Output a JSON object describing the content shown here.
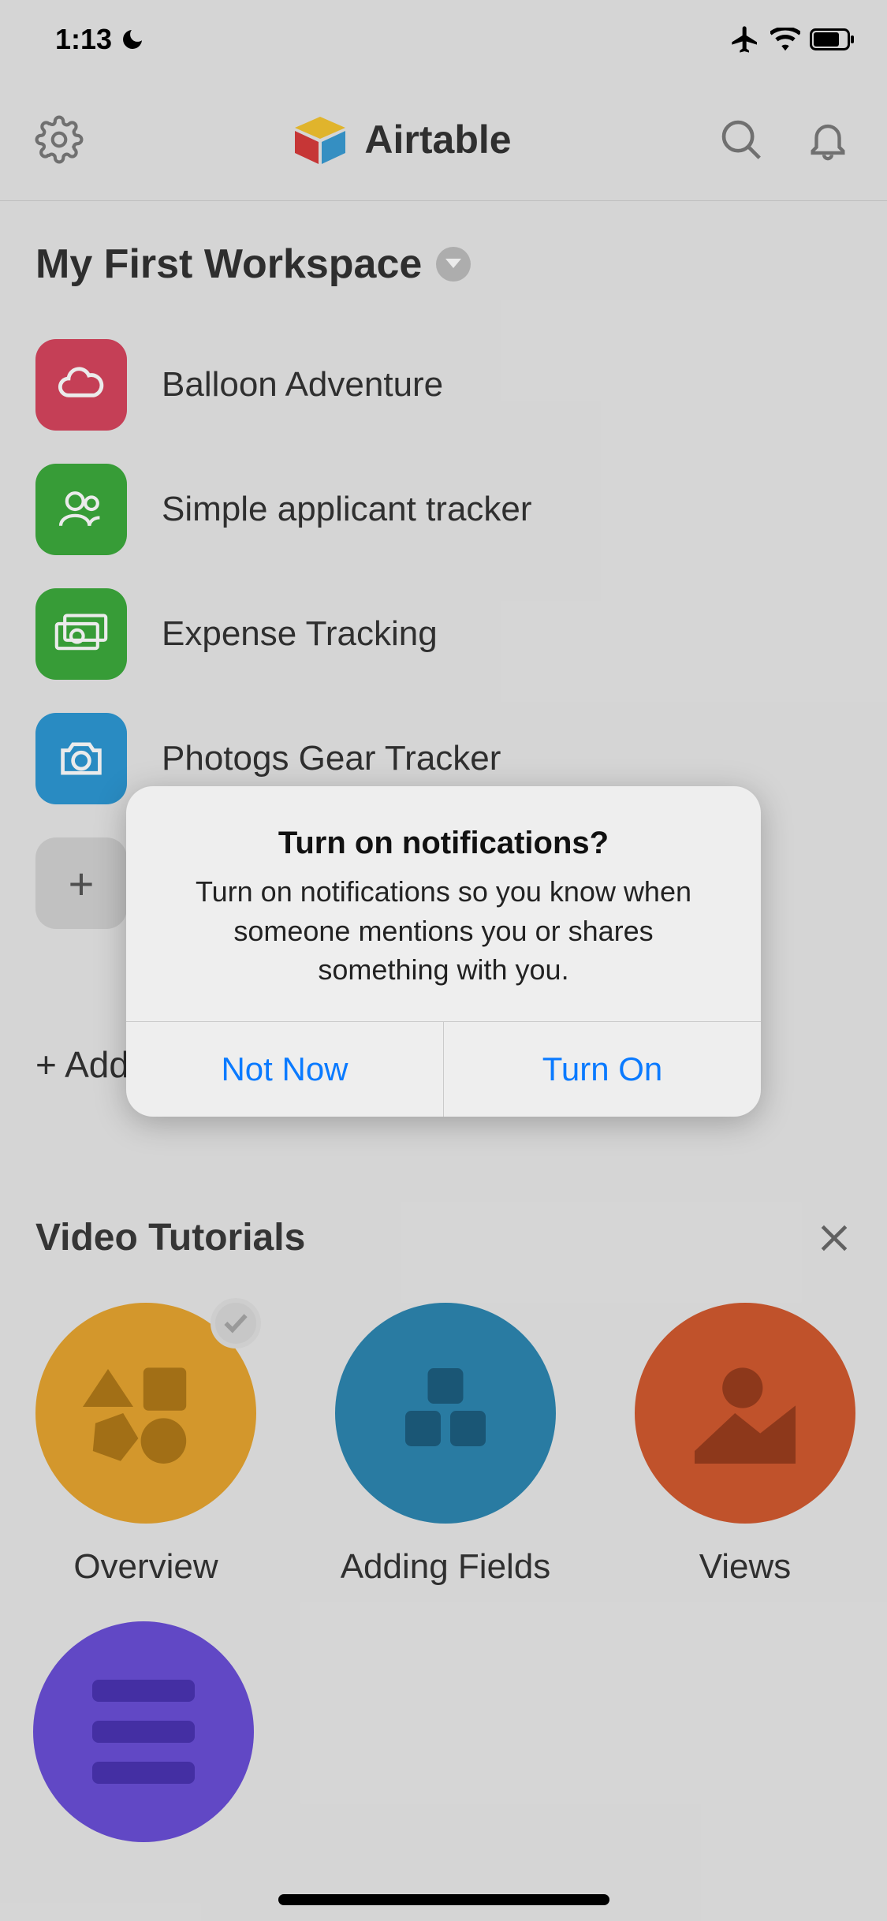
{
  "status": {
    "time": "1:13"
  },
  "header": {
    "brand": "Airtable"
  },
  "workspace": {
    "title": "My First Workspace",
    "bases": [
      {
        "name": "Balloon Adventure",
        "color": "red",
        "icon": "cloud"
      },
      {
        "name": "Simple applicant tracker",
        "color": "green",
        "icon": "people"
      },
      {
        "name": "Expense Tracking",
        "color": "green",
        "icon": "money"
      },
      {
        "name": "Photogs Gear Tracker",
        "color": "blue",
        "icon": "camera"
      }
    ],
    "add_placeholder": "+",
    "add_base_label": "+ Add a base"
  },
  "tutorials": {
    "title": "Video Tutorials",
    "items": [
      {
        "label": "Overview",
        "color": "orange",
        "checked": true
      },
      {
        "label": "Adding Fields",
        "color": "teal",
        "checked": false
      },
      {
        "label": "Views",
        "color": "rust",
        "checked": false
      }
    ]
  },
  "dialog": {
    "title": "Turn on notifications?",
    "body": "Turn on notifications so you know when someone mentions you or shares something with you.",
    "not_now": "Not Now",
    "turn_on": "Turn On"
  }
}
